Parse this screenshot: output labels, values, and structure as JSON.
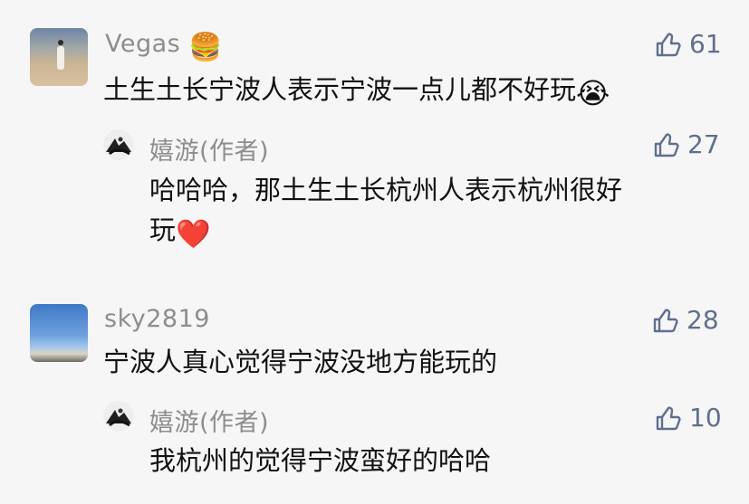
{
  "comments": [
    {
      "username": "Vegas",
      "username_emoji": "🍔",
      "likes": "61",
      "text": "土生土长宁波人表示宁波一点儿都不好玩",
      "text_emoji": "😭",
      "reply": {
        "username": "嬉游(作者)",
        "likes": "27",
        "text_line1": "哈哈哈，那土生土长杭州人表示杭州很好",
        "text_line2": "玩",
        "text_emoji": "❤️"
      }
    },
    {
      "username": "sky2819",
      "likes": "28",
      "text": "宁波人真心觉得宁波没地方能玩的",
      "reply": {
        "username": "嬉游(作者)",
        "likes": "10",
        "text": "我杭州的觉得宁波蛮好的哈哈"
      }
    }
  ],
  "icons": {
    "like": "thumbs-up-outline-icon",
    "author_avatar": "figure-ink-logo"
  },
  "colors": {
    "background": "#f6f6f6",
    "username": "#8d8d8d",
    "like": "#5f6f8e",
    "text": "#111111"
  }
}
